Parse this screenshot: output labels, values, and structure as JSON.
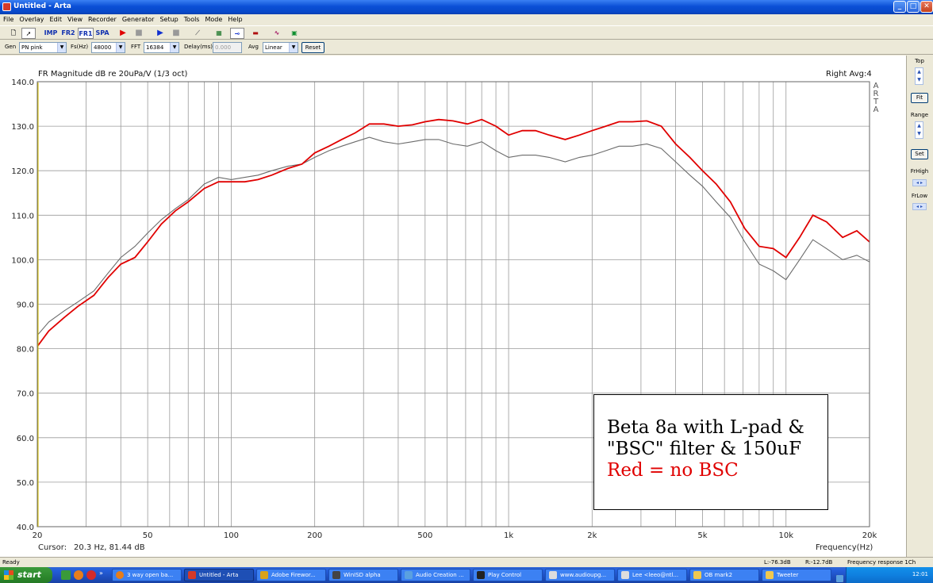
{
  "window": {
    "title": "Untitled - Arta"
  },
  "menu": [
    "File",
    "Overlay",
    "Edit",
    "View",
    "Recorder",
    "Generator",
    "Setup",
    "Tools",
    "Mode",
    "Help"
  ],
  "toolbar": {
    "buttons": [
      "IMP",
      "FR2",
      "FR1",
      "SPA"
    ]
  },
  "controls": {
    "gen_label": "Gen",
    "gen_value": "PN pink",
    "fs_label": "Fs(Hz)",
    "fs_value": "48000",
    "fft_label": "FFT",
    "fft_value": "16384",
    "delay_label": "Delay(ms)",
    "delay_value": "0.000",
    "avg_label": "Avg",
    "avg_value": "Linear",
    "reset_label": "Reset"
  },
  "side_panel": {
    "top_label": "Top",
    "fit_label": "Fit",
    "range_label": "Range",
    "set_label": "Set",
    "frhigh_label": "FrHigh",
    "frlow_label": "FrLow"
  },
  "graph": {
    "title": "FR Magnitude dB re 20uPa/V (1/3 oct)",
    "channel": "Right  Avg:4",
    "brand": [
      "A",
      "R",
      "T",
      "A"
    ],
    "cursor_label": "Cursor:",
    "cursor_value": "20.3 Hz, 81.44 dB",
    "xlabel": "Frequency(Hz)",
    "annotation": {
      "line1": "Beta 8a with L-pad &",
      "line2": "\"BSC\" filter & 150uF",
      "line3": "Red = no BSC",
      "line3_color": "#e00000"
    }
  },
  "status": {
    "left": "Ready",
    "level_l": "L:-76.3dB",
    "level_r": "R:-12.7dB",
    "mode": "Frequency response 1Ch"
  },
  "taskbar": {
    "start_label": "start",
    "tasks": [
      "3 way open ba...",
      "Untitled - Arta",
      "Adobe Firewor...",
      "WinISD alpha",
      "Audio Creation ...",
      "Play Control",
      "www.audioupg...",
      "Lee <leeo@ntl...",
      "OB mark2",
      "Tweeter"
    ],
    "clock": "12:01"
  },
  "chart_data": {
    "type": "line",
    "title": "FR Magnitude dB re 20uPa/V (1/3 oct)",
    "xlabel": "Frequency(Hz)",
    "ylabel": "",
    "x_scale": "log",
    "xlim": [
      20,
      20000
    ],
    "ylim": [
      40,
      140
    ],
    "x_ticks": [
      20,
      50,
      100,
      200,
      500,
      1000,
      2000,
      5000,
      10000,
      20000
    ],
    "x_tick_labels": [
      "20",
      "50",
      "100",
      "200",
      "500",
      "1k",
      "2k",
      "5k",
      "10k",
      "20k"
    ],
    "y_ticks": [
      40,
      50,
      60,
      70,
      80,
      90,
      100,
      110,
      120,
      130,
      140
    ],
    "y_tick_labels": [
      "40.0",
      "50.0",
      "60.0",
      "70.0",
      "80.0",
      "90.0",
      "100.0",
      "110.0",
      "120.0",
      "130.0",
      "140.0"
    ],
    "grid": true,
    "series": [
      {
        "color": "#e00000",
        "points": [
          [
            20,
            80.5
          ],
          [
            22,
            84
          ],
          [
            25,
            87
          ],
          [
            28,
            89.5
          ],
          [
            32,
            92
          ],
          [
            36,
            96
          ],
          [
            40,
            99
          ],
          [
            45,
            100.5
          ],
          [
            50,
            104
          ],
          [
            56,
            108
          ],
          [
            63,
            111
          ],
          [
            70,
            113
          ],
          [
            80,
            116
          ],
          [
            90,
            117.5
          ],
          [
            100,
            117.5
          ],
          [
            112,
            117.5
          ],
          [
            125,
            118
          ],
          [
            140,
            119
          ],
          [
            160,
            120.5
          ],
          [
            180,
            121.5
          ],
          [
            200,
            124
          ],
          [
            225,
            125.5
          ],
          [
            250,
            127
          ],
          [
            280,
            128.5
          ],
          [
            315,
            130.5
          ],
          [
            355,
            130.5
          ],
          [
            400,
            130
          ],
          [
            450,
            130.3
          ],
          [
            500,
            131
          ],
          [
            560,
            131.5
          ],
          [
            630,
            131.2
          ],
          [
            710,
            130.5
          ],
          [
            800,
            131.5
          ],
          [
            900,
            130
          ],
          [
            1000,
            128
          ],
          [
            1120,
            129
          ],
          [
            1250,
            129
          ],
          [
            1400,
            128
          ],
          [
            1600,
            127
          ],
          [
            1800,
            128
          ],
          [
            2000,
            129
          ],
          [
            2240,
            130
          ],
          [
            2500,
            131
          ],
          [
            2800,
            131
          ],
          [
            3150,
            131.2
          ],
          [
            3550,
            130
          ],
          [
            4000,
            126
          ],
          [
            4500,
            123
          ],
          [
            5000,
            120
          ],
          [
            5600,
            117
          ],
          [
            6300,
            113
          ],
          [
            7100,
            107
          ],
          [
            8000,
            103
          ],
          [
            9000,
            102.5
          ],
          [
            10000,
            100.5
          ],
          [
            11200,
            105
          ],
          [
            12500,
            110
          ],
          [
            14000,
            108.5
          ],
          [
            16000,
            105
          ],
          [
            18000,
            106.5
          ],
          [
            20000,
            104
          ]
        ]
      },
      {
        "color": "#6b6b6b",
        "points": [
          [
            20,
            83
          ],
          [
            22,
            86
          ],
          [
            25,
            88.5
          ],
          [
            28,
            90.5
          ],
          [
            32,
            93
          ],
          [
            36,
            97
          ],
          [
            40,
            100.5
          ],
          [
            45,
            103
          ],
          [
            50,
            106
          ],
          [
            56,
            109
          ],
          [
            63,
            111.5
          ],
          [
            70,
            113.5
          ],
          [
            80,
            117
          ],
          [
            90,
            118.5
          ],
          [
            100,
            118
          ],
          [
            112,
            118.5
          ],
          [
            125,
            119
          ],
          [
            140,
            120
          ],
          [
            160,
            121
          ],
          [
            180,
            121.5
          ],
          [
            200,
            123
          ],
          [
            225,
            124.5
          ],
          [
            250,
            125.5
          ],
          [
            280,
            126.5
          ],
          [
            315,
            127.5
          ],
          [
            355,
            126.5
          ],
          [
            400,
            126
          ],
          [
            450,
            126.5
          ],
          [
            500,
            127
          ],
          [
            560,
            127
          ],
          [
            630,
            126
          ],
          [
            710,
            125.5
          ],
          [
            800,
            126.5
          ],
          [
            900,
            124.5
          ],
          [
            1000,
            123
          ],
          [
            1120,
            123.5
          ],
          [
            1250,
            123.5
          ],
          [
            1400,
            123
          ],
          [
            1600,
            122
          ],
          [
            1800,
            123
          ],
          [
            2000,
            123.5
          ],
          [
            2240,
            124.5
          ],
          [
            2500,
            125.5
          ],
          [
            2800,
            125.5
          ],
          [
            3150,
            126
          ],
          [
            3550,
            125
          ],
          [
            4000,
            122
          ],
          [
            4500,
            119
          ],
          [
            5000,
            116.5
          ],
          [
            5600,
            113
          ],
          [
            6300,
            109.5
          ],
          [
            7100,
            104
          ],
          [
            8000,
            99
          ],
          [
            9000,
            97.5
          ],
          [
            10000,
            95.5
          ],
          [
            11200,
            100
          ],
          [
            12500,
            104.5
          ],
          [
            14000,
            102.5
          ],
          [
            16000,
            100
          ],
          [
            18000,
            101
          ],
          [
            20000,
            99.5
          ]
        ]
      }
    ]
  }
}
